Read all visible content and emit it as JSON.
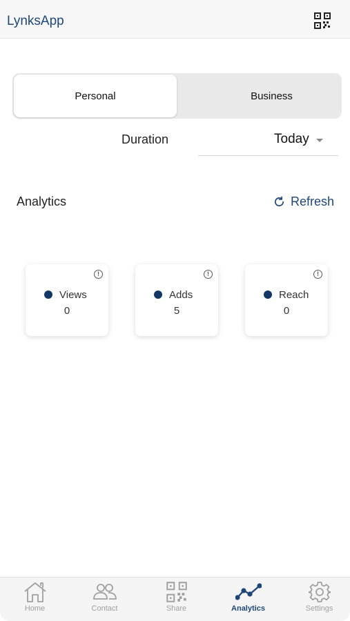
{
  "app": {
    "title": "LynksApp",
    "qr_icon": "qr-code-icon"
  },
  "segment": {
    "personal": "Personal",
    "business": "Business",
    "selected": "Personal"
  },
  "duration": {
    "label": "Duration",
    "value": "Today"
  },
  "analytics": {
    "title": "Analytics",
    "refresh": "Refresh"
  },
  "cards": [
    {
      "label": "Views",
      "value": "0"
    },
    {
      "label": "Adds",
      "value": "5"
    },
    {
      "label": "Reach",
      "value": "0"
    }
  ],
  "tabs": [
    {
      "label": "Home",
      "icon": "home-icon"
    },
    {
      "label": "Contact",
      "icon": "contacts-icon"
    },
    {
      "label": "Share",
      "icon": "qr-code-icon"
    },
    {
      "label": "Analytics",
      "icon": "analytics-icon"
    },
    {
      "label": "Settings",
      "icon": "gear-icon"
    }
  ],
  "active_tab": "Analytics",
  "colors": {
    "accent": "#1d4679",
    "dot": "#143866",
    "inactive_tab": "#a0a0a0"
  }
}
